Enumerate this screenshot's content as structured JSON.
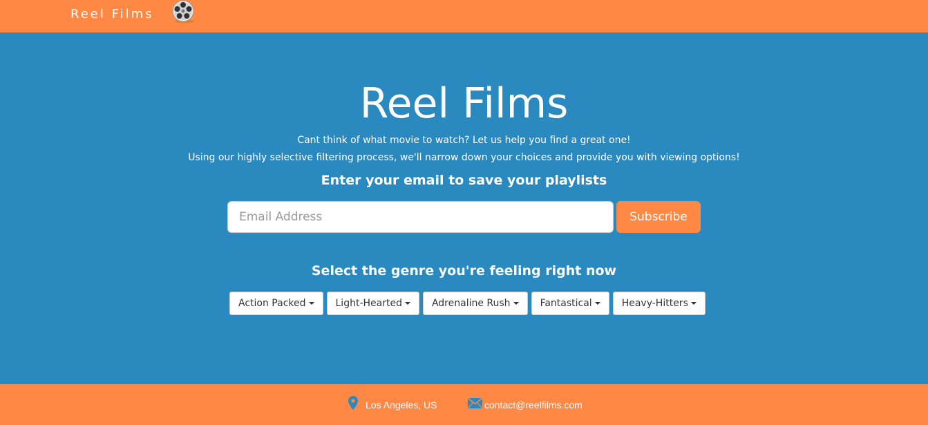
{
  "navbar": {
    "brand": "Reel Films",
    "logo_icon": "film-reel-icon"
  },
  "hero": {
    "title": "Reel Films",
    "tagline_1": "Cant think of what movie to watch? Let us help you find a great one!",
    "tagline_2": "Using our highly selective filtering process, we'll narrow down your choices and provide you with viewing options!",
    "email_heading": "Enter your email to save your playlists",
    "email_placeholder": "Email Address",
    "email_value": "",
    "subscribe_label": "Subscribe",
    "genre_heading": "Select the genre you're feeling right now",
    "genres": [
      {
        "label": "Action Packed"
      },
      {
        "label": "Light-Hearted"
      },
      {
        "label": "Adrenaline Rush"
      },
      {
        "label": "Fantastical"
      },
      {
        "label": "Heavy-Hitters"
      }
    ]
  },
  "footer": {
    "location": "Los Angeles, US",
    "location_icon": "map-pin-icon",
    "email": "contact@reelfilms.com",
    "email_icon": "envelope-icon"
  },
  "colors": {
    "primary_blue": "#2a89bf",
    "accent_orange": "#ff8844",
    "white": "#ffffff"
  }
}
